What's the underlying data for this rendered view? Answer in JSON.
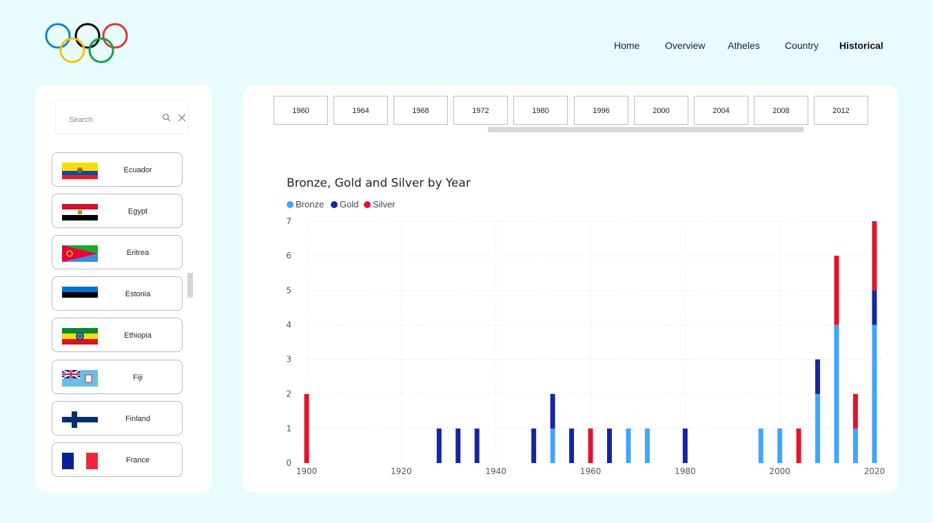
{
  "nav": {
    "items": [
      {
        "label": "Home",
        "active": false
      },
      {
        "label": "Overview",
        "active": false
      },
      {
        "label": "Atheles",
        "active": false
      },
      {
        "label": "Country",
        "active": false
      },
      {
        "label": "Historical",
        "active": true
      }
    ]
  },
  "logo": {
    "ring_colors": [
      "#0a85c8",
      "#000000",
      "#e3313c",
      "#f4c300",
      "#0fa147"
    ]
  },
  "search": {
    "placeholder": "Search",
    "icon": "search-icon",
    "clear_icon": "close-icon"
  },
  "countries": [
    {
      "name": "Ecuador",
      "flag": "flag-ecuador"
    },
    {
      "name": "Egypt",
      "flag": "flag-egypt"
    },
    {
      "name": "Eritrea",
      "flag": "flag-eritrea"
    },
    {
      "name": "Estonia",
      "flag": "flag-estonia"
    },
    {
      "name": "Ethiopia",
      "flag": "flag-ethiopia"
    },
    {
      "name": "Fiji",
      "flag": "flag-fiji"
    },
    {
      "name": "Finland",
      "flag": "flag-finland"
    },
    {
      "name": "France",
      "flag": "flag-france"
    }
  ],
  "year_slicer": [
    "1960",
    "1964",
    "1968",
    "1972",
    "1980",
    "1996",
    "2000",
    "2004",
    "2008",
    "2012"
  ],
  "colors": {
    "bronze": "#41a4ff",
    "gold": "#1626a0",
    "silver": "#e3132d"
  },
  "chart_data": {
    "type": "bar",
    "stacked": true,
    "title": "Bronze, Gold and Silver by Year",
    "xlabel": "",
    "ylabel": "",
    "xlim": [
      1900,
      2020
    ],
    "ylim": [
      0,
      7
    ],
    "x_ticks": [
      1900,
      1920,
      1940,
      1960,
      1980,
      2000,
      2020
    ],
    "y_ticks": [
      0,
      1,
      2,
      3,
      4,
      5,
      6,
      7
    ],
    "grid": true,
    "legend_position": "top-left",
    "series": [
      {
        "name": "Bronze",
        "color": "#41a4ff"
      },
      {
        "name": "Gold",
        "color": "#1626a0"
      },
      {
        "name": "Silver",
        "color": "#e3132d"
      }
    ],
    "data": [
      {
        "year": 1900,
        "Bronze": 0,
        "Gold": 0,
        "Silver": 2
      },
      {
        "year": 1928,
        "Bronze": 0,
        "Gold": 1,
        "Silver": 0
      },
      {
        "year": 1932,
        "Bronze": 0,
        "Gold": 1,
        "Silver": 0
      },
      {
        "year": 1936,
        "Bronze": 0,
        "Gold": 1,
        "Silver": 0
      },
      {
        "year": 1948,
        "Bronze": 0,
        "Gold": 1,
        "Silver": 0
      },
      {
        "year": 1952,
        "Bronze": 1,
        "Gold": 1,
        "Silver": 0
      },
      {
        "year": 1956,
        "Bronze": 0,
        "Gold": 1,
        "Silver": 0
      },
      {
        "year": 1960,
        "Bronze": 0,
        "Gold": 0,
        "Silver": 1
      },
      {
        "year": 1964,
        "Bronze": 0,
        "Gold": 1,
        "Silver": 0
      },
      {
        "year": 1968,
        "Bronze": 1,
        "Gold": 0,
        "Silver": 0
      },
      {
        "year": 1972,
        "Bronze": 1,
        "Gold": 0,
        "Silver": 0
      },
      {
        "year": 1980,
        "Bronze": 0,
        "Gold": 1,
        "Silver": 0
      },
      {
        "year": 1996,
        "Bronze": 1,
        "Gold": 0,
        "Silver": 0
      },
      {
        "year": 2000,
        "Bronze": 1,
        "Gold": 0,
        "Silver": 0
      },
      {
        "year": 2004,
        "Bronze": 0,
        "Gold": 0,
        "Silver": 1
      },
      {
        "year": 2008,
        "Bronze": 2,
        "Gold": 1,
        "Silver": 0
      },
      {
        "year": 2012,
        "Bronze": 4,
        "Gold": 0,
        "Silver": 2
      },
      {
        "year": 2016,
        "Bronze": 1,
        "Gold": 0,
        "Silver": 1
      },
      {
        "year": 2020,
        "Bronze": 4,
        "Gold": 1,
        "Silver": 2
      }
    ]
  }
}
